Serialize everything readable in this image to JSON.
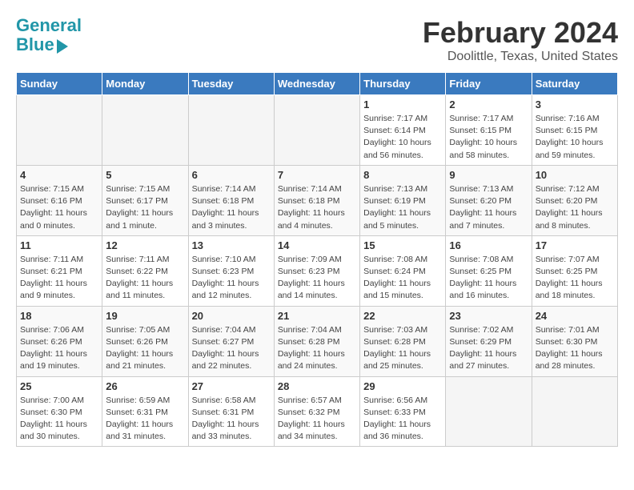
{
  "header": {
    "logo_line1": "General",
    "logo_line2": "Blue",
    "title": "February 2024",
    "subtitle": "Doolittle, Texas, United States"
  },
  "days_of_week": [
    "Sunday",
    "Monday",
    "Tuesday",
    "Wednesday",
    "Thursday",
    "Friday",
    "Saturday"
  ],
  "weeks": [
    [
      {
        "day": "",
        "info": ""
      },
      {
        "day": "",
        "info": ""
      },
      {
        "day": "",
        "info": ""
      },
      {
        "day": "",
        "info": ""
      },
      {
        "day": "1",
        "info": "Sunrise: 7:17 AM\nSunset: 6:14 PM\nDaylight: 10 hours\nand 56 minutes."
      },
      {
        "day": "2",
        "info": "Sunrise: 7:17 AM\nSunset: 6:15 PM\nDaylight: 10 hours\nand 58 minutes."
      },
      {
        "day": "3",
        "info": "Sunrise: 7:16 AM\nSunset: 6:15 PM\nDaylight: 10 hours\nand 59 minutes."
      }
    ],
    [
      {
        "day": "4",
        "info": "Sunrise: 7:15 AM\nSunset: 6:16 PM\nDaylight: 11 hours\nand 0 minutes."
      },
      {
        "day": "5",
        "info": "Sunrise: 7:15 AM\nSunset: 6:17 PM\nDaylight: 11 hours\nand 1 minute."
      },
      {
        "day": "6",
        "info": "Sunrise: 7:14 AM\nSunset: 6:18 PM\nDaylight: 11 hours\nand 3 minutes."
      },
      {
        "day": "7",
        "info": "Sunrise: 7:14 AM\nSunset: 6:18 PM\nDaylight: 11 hours\nand 4 minutes."
      },
      {
        "day": "8",
        "info": "Sunrise: 7:13 AM\nSunset: 6:19 PM\nDaylight: 11 hours\nand 5 minutes."
      },
      {
        "day": "9",
        "info": "Sunrise: 7:13 AM\nSunset: 6:20 PM\nDaylight: 11 hours\nand 7 minutes."
      },
      {
        "day": "10",
        "info": "Sunrise: 7:12 AM\nSunset: 6:20 PM\nDaylight: 11 hours\nand 8 minutes."
      }
    ],
    [
      {
        "day": "11",
        "info": "Sunrise: 7:11 AM\nSunset: 6:21 PM\nDaylight: 11 hours\nand 9 minutes."
      },
      {
        "day": "12",
        "info": "Sunrise: 7:11 AM\nSunset: 6:22 PM\nDaylight: 11 hours\nand 11 minutes."
      },
      {
        "day": "13",
        "info": "Sunrise: 7:10 AM\nSunset: 6:23 PM\nDaylight: 11 hours\nand 12 minutes."
      },
      {
        "day": "14",
        "info": "Sunrise: 7:09 AM\nSunset: 6:23 PM\nDaylight: 11 hours\nand 14 minutes."
      },
      {
        "day": "15",
        "info": "Sunrise: 7:08 AM\nSunset: 6:24 PM\nDaylight: 11 hours\nand 15 minutes."
      },
      {
        "day": "16",
        "info": "Sunrise: 7:08 AM\nSunset: 6:25 PM\nDaylight: 11 hours\nand 16 minutes."
      },
      {
        "day": "17",
        "info": "Sunrise: 7:07 AM\nSunset: 6:25 PM\nDaylight: 11 hours\nand 18 minutes."
      }
    ],
    [
      {
        "day": "18",
        "info": "Sunrise: 7:06 AM\nSunset: 6:26 PM\nDaylight: 11 hours\nand 19 minutes."
      },
      {
        "day": "19",
        "info": "Sunrise: 7:05 AM\nSunset: 6:26 PM\nDaylight: 11 hours\nand 21 minutes."
      },
      {
        "day": "20",
        "info": "Sunrise: 7:04 AM\nSunset: 6:27 PM\nDaylight: 11 hours\nand 22 minutes."
      },
      {
        "day": "21",
        "info": "Sunrise: 7:04 AM\nSunset: 6:28 PM\nDaylight: 11 hours\nand 24 minutes."
      },
      {
        "day": "22",
        "info": "Sunrise: 7:03 AM\nSunset: 6:28 PM\nDaylight: 11 hours\nand 25 minutes."
      },
      {
        "day": "23",
        "info": "Sunrise: 7:02 AM\nSunset: 6:29 PM\nDaylight: 11 hours\nand 27 minutes."
      },
      {
        "day": "24",
        "info": "Sunrise: 7:01 AM\nSunset: 6:30 PM\nDaylight: 11 hours\nand 28 minutes."
      }
    ],
    [
      {
        "day": "25",
        "info": "Sunrise: 7:00 AM\nSunset: 6:30 PM\nDaylight: 11 hours\nand 30 minutes."
      },
      {
        "day": "26",
        "info": "Sunrise: 6:59 AM\nSunset: 6:31 PM\nDaylight: 11 hours\nand 31 minutes."
      },
      {
        "day": "27",
        "info": "Sunrise: 6:58 AM\nSunset: 6:31 PM\nDaylight: 11 hours\nand 33 minutes."
      },
      {
        "day": "28",
        "info": "Sunrise: 6:57 AM\nSunset: 6:32 PM\nDaylight: 11 hours\nand 34 minutes."
      },
      {
        "day": "29",
        "info": "Sunrise: 6:56 AM\nSunset: 6:33 PM\nDaylight: 11 hours\nand 36 minutes."
      },
      {
        "day": "",
        "info": ""
      },
      {
        "day": "",
        "info": ""
      }
    ]
  ]
}
